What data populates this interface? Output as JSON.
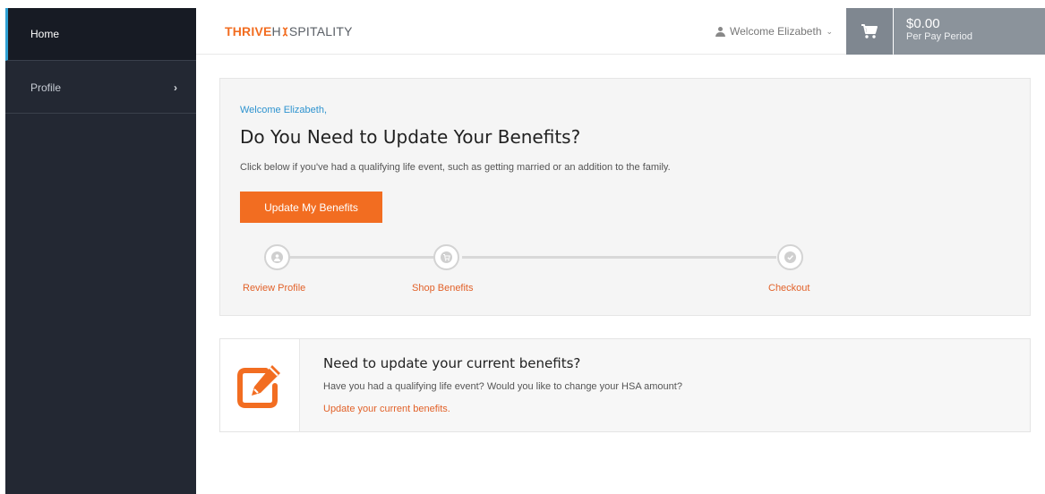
{
  "sidebar": {
    "items": [
      {
        "label": "Home"
      },
      {
        "label": "Profile"
      }
    ]
  },
  "header": {
    "logo_part1": "THRIVE",
    "logo_part2": "H",
    "logo_part3": "SPITALITY",
    "welcome": "Welcome Elizabeth",
    "cart_total": "$0.00",
    "cart_period": "Per Pay Period"
  },
  "hero": {
    "greeting": "Welcome Elizabeth,",
    "title": "Do You Need to Update Your Benefits?",
    "description": "Click below if you've had a qualifying life event, such as getting married or an addition to the family.",
    "button_label": "Update My Benefits",
    "steps": [
      {
        "label": "Review Profile",
        "icon": "user-icon"
      },
      {
        "label": "Shop Benefits",
        "icon": "cart-icon"
      },
      {
        "label": "Checkout",
        "icon": "check-icon"
      }
    ]
  },
  "card": {
    "icon": "edit-icon",
    "title": "Need to update your current benefits?",
    "question": "Have you had a qualifying life event? Would you like to change your HSA amount?",
    "link": "Update your current benefits."
  },
  "colors": {
    "accent": "#f26d21",
    "link_blue": "#2e93cf",
    "sidebar_bg": "#232833"
  }
}
